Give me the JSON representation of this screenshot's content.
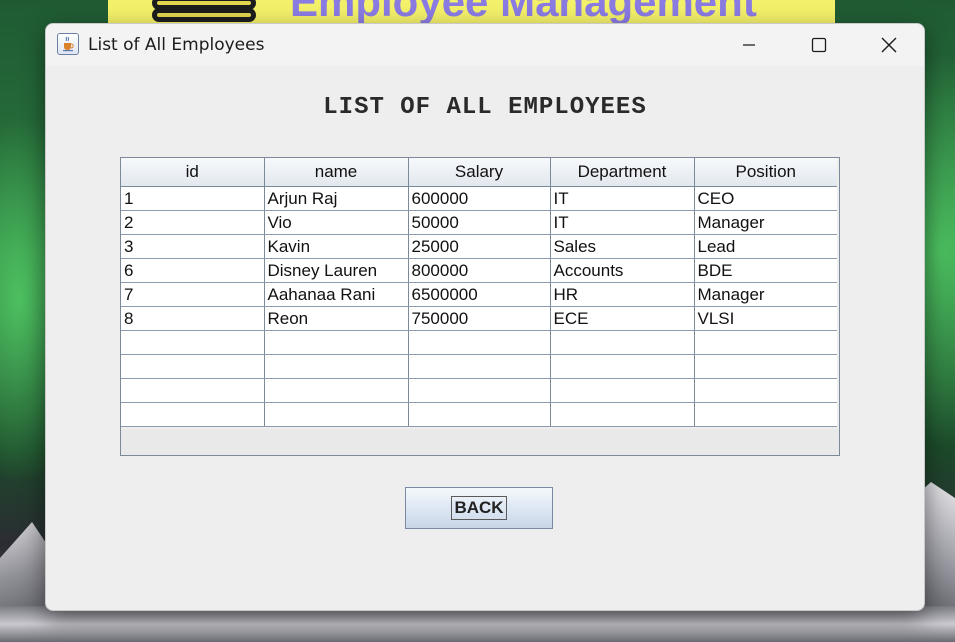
{
  "banner": {
    "title": "Employee Management"
  },
  "window": {
    "title": "List of All Employees",
    "icon": "java-cup-icon",
    "controls": [
      "minimize-icon",
      "maximize-icon",
      "close-icon"
    ]
  },
  "heading": "LIST OF ALL EMPLOYEES",
  "table": {
    "columns": [
      "id",
      "name",
      "Salary",
      "Department",
      "Position"
    ],
    "rows": [
      [
        "1",
        "Arjun Raj",
        "600000",
        "IT",
        "CEO"
      ],
      [
        "2",
        "Vio",
        "50000",
        "IT",
        "Manager"
      ],
      [
        "3",
        "Kavin",
        "25000",
        "Sales",
        "Lead"
      ],
      [
        "6",
        "Disney Lauren",
        "800000",
        "Accounts",
        "BDE"
      ],
      [
        "7",
        "Aahanaa Rani",
        "6500000",
        "HR",
        "Manager"
      ],
      [
        "8",
        "Reon",
        "750000",
        "ECE",
        "VLSI"
      ],
      [
        "",
        "",
        "",
        "",
        ""
      ],
      [
        "",
        "",
        "",
        "",
        ""
      ],
      [
        "",
        "",
        "",
        "",
        ""
      ],
      [
        "",
        "",
        "",
        "",
        ""
      ]
    ]
  },
  "back_button": {
    "label": "BACK"
  },
  "colors": {
    "banner_bg": "#f3f06a",
    "banner_text": "#8a7be3",
    "window_bg": "#eeeeee",
    "grid_line": "#7a8a99"
  }
}
